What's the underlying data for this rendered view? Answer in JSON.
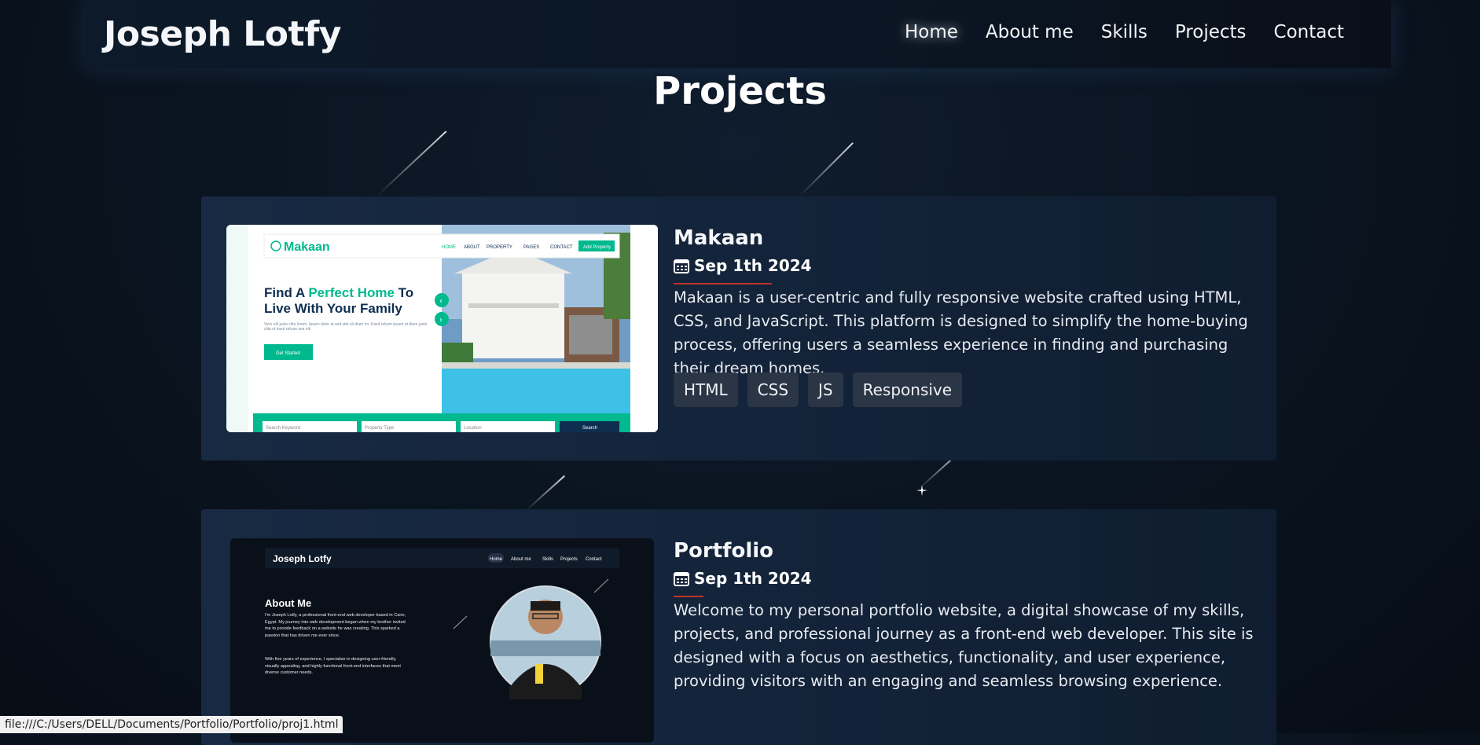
{
  "nav": {
    "brand": "Joseph Lotfy",
    "links": [
      "Home",
      "About me",
      "Skills",
      "Projects",
      "Contact"
    ],
    "active": "Home"
  },
  "page": {
    "title": "Projects"
  },
  "projects": [
    {
      "title": "Makaan",
      "date": "Sep 1th 2024",
      "description": "Makaan is a user-centric and fully responsive website crafted using HTML, CSS, and JavaScript. This platform is designed to simplify the home-buying process, offering users a seamless experience in finding and purchasing their dream homes.",
      "tags": [
        "HTML",
        "CSS",
        "JS",
        "Responsive"
      ],
      "preview": {
        "logo": "Makaan",
        "nav": [
          "HOME",
          "ABOUT",
          "PROPERTY",
          "PAGES",
          "CONTACT"
        ],
        "cta": "Add Property",
        "headline_a": "Find A ",
        "headline_b": "Perfect Home",
        "headline_c": " To",
        "headline_d": "Live With Your Family",
        "body": "Vero elit justo clita lorem. Ipsum dolor at sed stet sit diam no. Kasd rebum ipsum et diam justo clita et kasd rebum sea elit",
        "button": "Get Started",
        "search_fields": [
          "Search Keyword",
          "Property Type",
          "Location"
        ],
        "search_button": "Search"
      }
    },
    {
      "title": "Portfolio",
      "date": "Sep 1th 2024",
      "description": "Welcome to my personal portfolio website, a digital showcase of my skills, projects, and professional journey as a front-end web developer. This site is designed with a focus on aesthetics, functionality, and user experience, providing visitors with an engaging and seamless browsing experience.",
      "preview": {
        "brand": "Joseph Lotfy",
        "nav": [
          "Home",
          "About me",
          "Skills",
          "Projects",
          "Contact"
        ],
        "heading": "About Me",
        "para1": "I'm Joseph Lotfy, a professional front-end web developer based in Cairo, Egypt. My journey into web development began when my brother invited me to provide feedback on a website he was creating. This sparked a passion that has driven me ever since.",
        "para2": "With five years of experience, I specialize in designing user-friendly, visually appealing, and highly functional front-end interfaces that meet diverse customer needs."
      }
    }
  ],
  "status_bar": {
    "url": "file:///C:/Users/DELL/Documents/Portfolio/Portfolio/proj1.html"
  },
  "colors": {
    "accent_red": "#c0322b",
    "makaan_green": "#00b98e",
    "card_bg": "#162740"
  }
}
